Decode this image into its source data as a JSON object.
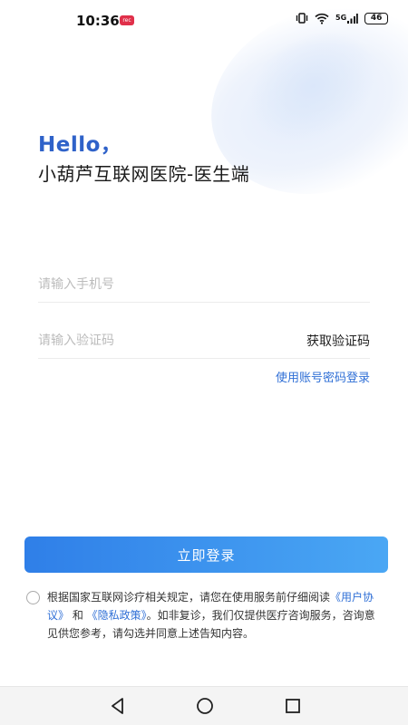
{
  "status_bar": {
    "time": "10:36",
    "recording_badge": "rec",
    "network_label": "5G",
    "battery_level": "46",
    "icons": [
      "vibrate-icon",
      "wifi-icon",
      "signal-icon",
      "battery-icon"
    ]
  },
  "header": {
    "greeting": "Hello，",
    "app_title": "小葫芦互联网医院-医生端"
  },
  "form": {
    "phone_placeholder": "请输入手机号",
    "code_placeholder": "请输入验证码",
    "get_code_label": "获取验证码",
    "password_login_link": "使用账号密码登录"
  },
  "login_button": {
    "label": "立即登录"
  },
  "agreement": {
    "text_before": "根据国家互联网诊疗相关规定，请您在使用服务前仔细阅读",
    "user_agreement": "《用户协议》",
    "connector": " 和 ",
    "privacy_policy": "《隐私政策》",
    "text_after": "。如非复诊，我们仅提供医疗咨询服务，咨询意见供您参考，请勾选并同意上述告知内容。"
  },
  "nav_bar": {
    "icons": [
      "back-icon",
      "home-icon",
      "recents-icon"
    ]
  },
  "colors": {
    "accent": "#2f62c9",
    "link": "#2f6fd6",
    "button_start": "#2f7fe8",
    "button_end": "#4aa7f4"
  }
}
